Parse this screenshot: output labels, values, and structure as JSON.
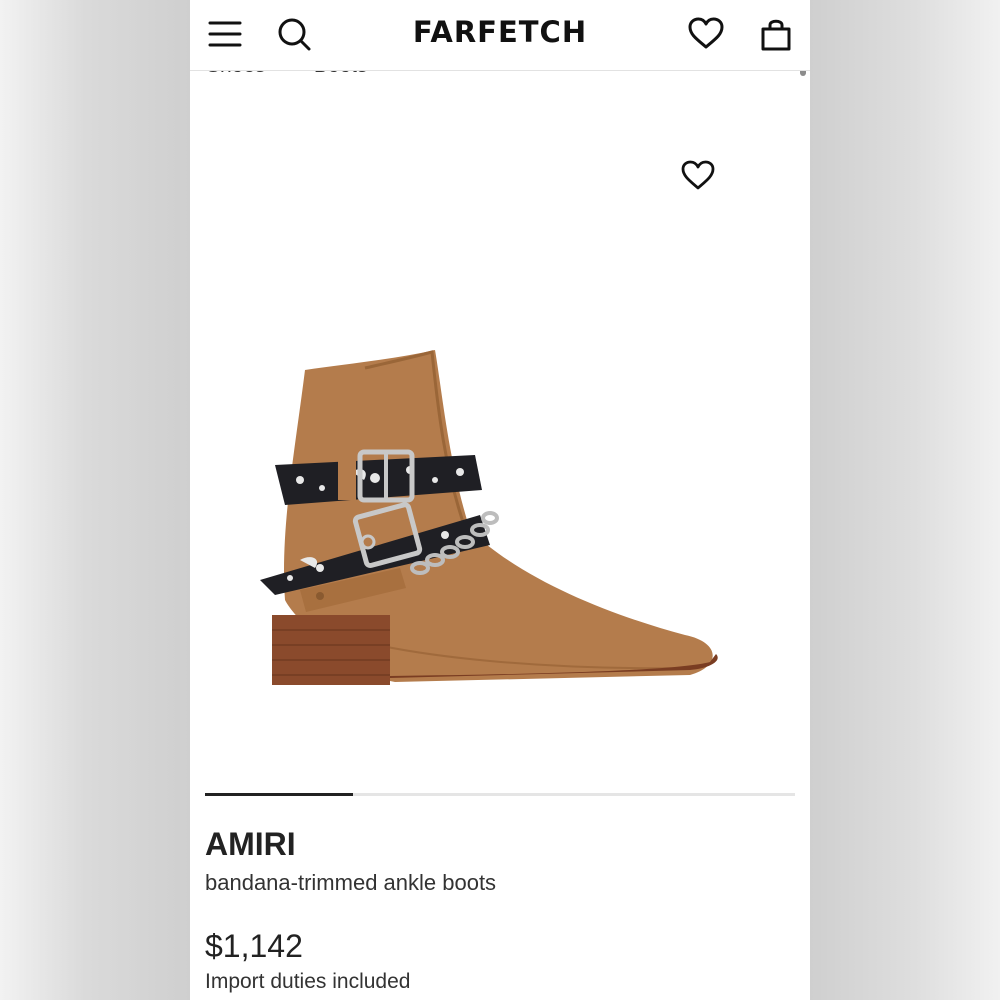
{
  "header": {
    "logo": "FARFETCH",
    "icons": [
      "menu-icon",
      "search-icon",
      "wishlist-icon",
      "bag-icon"
    ]
  },
  "breadcrumb": {
    "items": [
      "Shoes",
      "Boots"
    ],
    "separator": ">"
  },
  "gallery": {
    "favorite_icon": "heart-outline-icon",
    "image_subject": "suede ankle boot with bandana straps and chain",
    "slide_progress": 0.25
  },
  "product": {
    "brand": "AMIRI",
    "name": "bandana-trimmed ankle boots",
    "price": "$1,142",
    "duties_note": "Import duties included"
  },
  "colors": {
    "text": "#222222",
    "suede": "#b47c4c",
    "heel": "#8a4a2c"
  }
}
